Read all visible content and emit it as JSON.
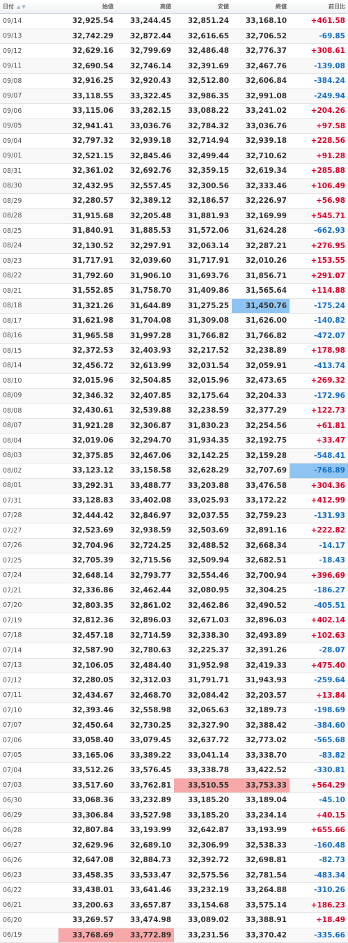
{
  "header": {
    "date": "日付",
    "open": "始値",
    "high": "高値",
    "low": "安値",
    "close": "終値",
    "change": "前日比",
    "sort_icons": "▲▼"
  },
  "colors": {
    "positive": "#e0002a",
    "negative": "#1570c4",
    "highlight_high": "#f7a8a8",
    "highlight_low": "#8ec4f2"
  },
  "rows": [
    {
      "date": "09/14",
      "open": "32,925.54",
      "high": "33,244.45",
      "low": "32,851.24",
      "close": "33,168.10",
      "change": "+461.58"
    },
    {
      "date": "09/13",
      "open": "32,742.29",
      "high": "32,872.44",
      "low": "32,616.65",
      "close": "32,706.52",
      "change": "-69.85"
    },
    {
      "date": "09/12",
      "open": "32,629.16",
      "high": "32,799.69",
      "low": "32,486.48",
      "close": "32,776.37",
      "change": "+308.61"
    },
    {
      "date": "09/11",
      "open": "32,690.54",
      "high": "32,746.14",
      "low": "32,391.69",
      "close": "32,467.76",
      "change": "-139.08"
    },
    {
      "date": "09/08",
      "open": "32,916.25",
      "high": "32,920.43",
      "low": "32,512.80",
      "close": "32,606.84",
      "change": "-384.24"
    },
    {
      "date": "09/07",
      "open": "33,118.55",
      "high": "33,322.45",
      "low": "32,986.35",
      "close": "32,991.08",
      "change": "-249.94"
    },
    {
      "date": "09/06",
      "open": "33,115.06",
      "high": "33,282.15",
      "low": "33,088.22",
      "close": "33,241.02",
      "change": "+204.26"
    },
    {
      "date": "09/05",
      "open": "32,941.41",
      "high": "33,036.76",
      "low": "32,784.32",
      "close": "33,036.76",
      "change": "+97.58"
    },
    {
      "date": "09/04",
      "open": "32,797.32",
      "high": "32,939.18",
      "low": "32,714.94",
      "close": "32,939.18",
      "change": "+228.56"
    },
    {
      "date": "09/01",
      "open": "32,521.15",
      "high": "32,845.46",
      "low": "32,499.44",
      "close": "32,710.62",
      "change": "+91.28"
    },
    {
      "date": "08/31",
      "open": "32,361.02",
      "high": "32,692.76",
      "low": "32,359.15",
      "close": "32,619.34",
      "change": "+285.88"
    },
    {
      "date": "08/30",
      "open": "32,432.95",
      "high": "32,557.45",
      "low": "32,300.56",
      "close": "32,333.46",
      "change": "+106.49"
    },
    {
      "date": "08/29",
      "open": "32,280.57",
      "high": "32,389.12",
      "low": "32,186.57",
      "close": "32,226.97",
      "change": "+56.98"
    },
    {
      "date": "08/28",
      "open": "31,915.68",
      "high": "32,205.48",
      "low": "31,881.93",
      "close": "32,169.99",
      "change": "+545.71"
    },
    {
      "date": "08/25",
      "open": "31,840.91",
      "high": "31,885.53",
      "low": "31,572.06",
      "close": "31,624.28",
      "change": "-662.93"
    },
    {
      "date": "08/24",
      "open": "32,130.52",
      "high": "32,297.91",
      "low": "32,063.14",
      "close": "32,287.21",
      "change": "+276.95"
    },
    {
      "date": "08/23",
      "open": "31,717.91",
      "high": "32,039.60",
      "low": "31,717.91",
      "close": "32,010.26",
      "change": "+153.55"
    },
    {
      "date": "08/22",
      "open": "31,792.60",
      "high": "31,906.10",
      "low": "31,693.76",
      "close": "31,856.71",
      "change": "+291.07"
    },
    {
      "date": "08/21",
      "open": "31,552.85",
      "high": "31,758.70",
      "low": "31,409.86",
      "close": "31,565.64",
      "change": "+114.88"
    },
    {
      "date": "08/18",
      "open": "31,321.26",
      "high": "31,644.89",
      "low": "31,275.25",
      "close": "31,450.76",
      "change": "-175.24",
      "hl": {
        "close": "blue"
      }
    },
    {
      "date": "08/17",
      "open": "31,621.98",
      "high": "31,704.08",
      "low": "31,309.08",
      "close": "31,626.00",
      "change": "-140.82"
    },
    {
      "date": "08/16",
      "open": "31,965.58",
      "high": "31,997.28",
      "low": "31,766.82",
      "close": "31,766.82",
      "change": "-472.07"
    },
    {
      "date": "08/15",
      "open": "32,372.53",
      "high": "32,403.93",
      "low": "32,217.52",
      "close": "32,238.89",
      "change": "+178.98"
    },
    {
      "date": "08/14",
      "open": "32,456.72",
      "high": "32,613.99",
      "low": "32,031.54",
      "close": "32,059.91",
      "change": "-413.74"
    },
    {
      "date": "08/10",
      "open": "32,015.96",
      "high": "32,504.85",
      "low": "32,015.96",
      "close": "32,473.65",
      "change": "+269.32"
    },
    {
      "date": "08/09",
      "open": "32,346.32",
      "high": "32,407.85",
      "low": "32,175.64",
      "close": "32,204.33",
      "change": "-172.96"
    },
    {
      "date": "08/08",
      "open": "32,430.61",
      "high": "32,539.88",
      "low": "32,238.59",
      "close": "32,377.29",
      "change": "+122.73"
    },
    {
      "date": "08/07",
      "open": "31,921.28",
      "high": "32,306.87",
      "low": "31,830.23",
      "close": "32,254.56",
      "change": "+61.81"
    },
    {
      "date": "08/04",
      "open": "32,019.06",
      "high": "32,294.70",
      "low": "31,934.35",
      "close": "32,192.75",
      "change": "+33.47"
    },
    {
      "date": "08/03",
      "open": "32,375.85",
      "high": "32,467.06",
      "low": "32,142.25",
      "close": "32,159.28",
      "change": "-548.41"
    },
    {
      "date": "08/02",
      "open": "33,123.12",
      "high": "33,158.58",
      "low": "32,628.29",
      "close": "32,707.69",
      "change": "-768.89",
      "hl": {
        "change": "blue"
      }
    },
    {
      "date": "08/01",
      "open": "33,292.31",
      "high": "33,488.77",
      "low": "33,203.88",
      "close": "33,476.58",
      "change": "+304.36"
    },
    {
      "date": "07/31",
      "open": "33,128.83",
      "high": "33,402.08",
      "low": "33,025.93",
      "close": "33,172.22",
      "change": "+412.99"
    },
    {
      "date": "07/28",
      "open": "32,444.42",
      "high": "32,846.97",
      "low": "32,037.55",
      "close": "32,759.23",
      "change": "-131.93"
    },
    {
      "date": "07/27",
      "open": "32,523.69",
      "high": "32,938.59",
      "low": "32,503.69",
      "close": "32,891.16",
      "change": "+222.82"
    },
    {
      "date": "07/26",
      "open": "32,704.96",
      "high": "32,724.25",
      "low": "32,488.52",
      "close": "32,668.34",
      "change": "-14.17"
    },
    {
      "date": "07/25",
      "open": "32,705.39",
      "high": "32,715.56",
      "low": "32,509.94",
      "close": "32,682.51",
      "change": "-18.43"
    },
    {
      "date": "07/24",
      "open": "32,648.14",
      "high": "32,793.77",
      "low": "32,554.46",
      "close": "32,700.94",
      "change": "+396.69"
    },
    {
      "date": "07/21",
      "open": "32,336.86",
      "high": "32,462.44",
      "low": "32,080.95",
      "close": "32,304.25",
      "change": "-186.27"
    },
    {
      "date": "07/20",
      "open": "32,803.35",
      "high": "32,861.02",
      "low": "32,462.86",
      "close": "32,490.52",
      "change": "-405.51"
    },
    {
      "date": "07/19",
      "open": "32,812.36",
      "high": "32,896.03",
      "low": "32,671.03",
      "close": "32,896.03",
      "change": "+402.14"
    },
    {
      "date": "07/18",
      "open": "32,457.18",
      "high": "32,714.59",
      "low": "32,338.30",
      "close": "32,493.89",
      "change": "+102.63"
    },
    {
      "date": "07/14",
      "open": "32,587.90",
      "high": "32,780.63",
      "low": "32,225.37",
      "close": "32,391.26",
      "change": "-28.07"
    },
    {
      "date": "07/13",
      "open": "32,106.05",
      "high": "32,484.40",
      "low": "31,952.98",
      "close": "32,419.33",
      "change": "+475.40"
    },
    {
      "date": "07/12",
      "open": "32,280.05",
      "high": "32,312.03",
      "low": "31,791.71",
      "close": "31,943.93",
      "change": "-259.64"
    },
    {
      "date": "07/11",
      "open": "32,434.67",
      "high": "32,468.70",
      "low": "32,084.42",
      "close": "32,203.57",
      "change": "+13.84"
    },
    {
      "date": "07/10",
      "open": "32,393.46",
      "high": "32,558.98",
      "low": "32,065.63",
      "close": "32,189.73",
      "change": "-198.69"
    },
    {
      "date": "07/07",
      "open": "32,450.64",
      "high": "32,730.25",
      "low": "32,327.90",
      "close": "32,388.42",
      "change": "-384.60"
    },
    {
      "date": "07/06",
      "open": "33,058.40",
      "high": "33,079.45",
      "low": "32,637.72",
      "close": "32,773.02",
      "change": "-565.68"
    },
    {
      "date": "07/05",
      "open": "33,165.06",
      "high": "33,389.22",
      "low": "33,041.14",
      "close": "33,338.70",
      "change": "-83.82"
    },
    {
      "date": "07/04",
      "open": "33,512.26",
      "high": "33,576.45",
      "low": "33,338.78",
      "close": "33,422.52",
      "change": "-330.81"
    },
    {
      "date": "07/03",
      "open": "33,517.60",
      "high": "33,762.81",
      "low": "33,510.55",
      "close": "33,753.33",
      "change": "+564.29",
      "hl": {
        "low": "pink",
        "close": "pink"
      }
    },
    {
      "date": "06/30",
      "open": "33,068.36",
      "high": "33,232.89",
      "low": "33,185.20",
      "close": "33,189.04",
      "change": "-45.10"
    },
    {
      "date": "06/29",
      "open": "33,306.84",
      "high": "33,527.98",
      "low": "33,185.20",
      "close": "33,234.14",
      "change": "+40.15"
    },
    {
      "date": "06/28",
      "open": "32,807.84",
      "high": "33,193.99",
      "low": "32,642.87",
      "close": "33,193.99",
      "change": "+655.66"
    },
    {
      "date": "06/27",
      "open": "32,629.96",
      "high": "32,689.10",
      "low": "32,306.99",
      "close": "32,538.33",
      "change": "-160.48"
    },
    {
      "date": "06/26",
      "open": "32,647.08",
      "high": "32,884.73",
      "low": "32,392.72",
      "close": "32,698.81",
      "change": "-82.73"
    },
    {
      "date": "06/23",
      "open": "33,458.35",
      "high": "33,533.47",
      "low": "32,575.56",
      "close": "32,781.54",
      "change": "-483.34"
    },
    {
      "date": "06/22",
      "open": "33,438.01",
      "high": "33,641.46",
      "low": "33,232.19",
      "close": "33,264.88",
      "change": "-310.26"
    },
    {
      "date": "06/21",
      "open": "33,200.63",
      "high": "33,657.87",
      "low": "33,154.68",
      "close": "33,575.14",
      "change": "+186.23"
    },
    {
      "date": "06/20",
      "open": "33,269.57",
      "high": "33,474.98",
      "low": "33,089.02",
      "close": "33,388.91",
      "change": "+18.49"
    },
    {
      "date": "06/19",
      "open": "33,768.69",
      "high": "33,772.89",
      "low": "33,231.56",
      "close": "33,370.42",
      "change": "-335.66",
      "hl": {
        "open": "pink",
        "high": "pink"
      }
    }
  ]
}
